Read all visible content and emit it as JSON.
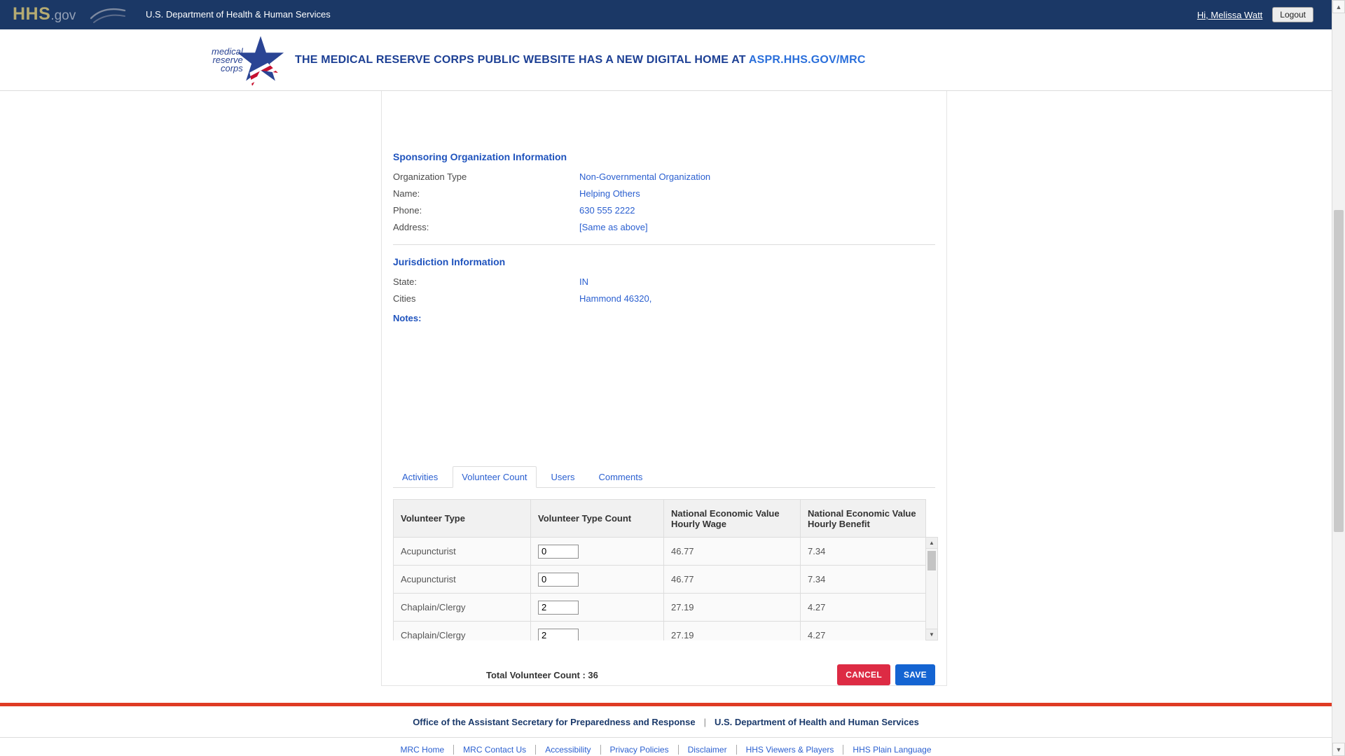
{
  "topbar": {
    "brand_primary": "HHS",
    "brand_suffix": ".gov",
    "department": "U.S. Department of Health & Human Services",
    "greeting": "Hi, Melissa Watt",
    "logout_label": "Logout"
  },
  "banner": {
    "logo_words": [
      "medical",
      "reserve",
      "corps"
    ],
    "message": "THE MEDICAL RESERVE CORPS PUBLIC WEBSITE HAS A NEW DIGITAL HOME AT",
    "link_text": "ASPR.HHS.GOV/MRC"
  },
  "sponsoring": {
    "title": "Sponsoring Organization Information",
    "fields": [
      {
        "label": "Organization Type",
        "value": "Non-Governmental Organization"
      },
      {
        "label": "Name:",
        "value": "Helping Others"
      },
      {
        "label": "Phone:",
        "value": "630 555 2222"
      },
      {
        "label": "Address:",
        "value": "[Same as above]"
      }
    ]
  },
  "jurisdiction": {
    "title": "Jurisdiction Information",
    "fields": [
      {
        "label": "State:",
        "value": "IN"
      },
      {
        "label": "Cities",
        "value": "Hammond 46320,"
      }
    ],
    "notes_label": "Notes:"
  },
  "tabs": [
    {
      "label": "Activities",
      "active": false
    },
    {
      "label": "Volunteer Count",
      "active": true
    },
    {
      "label": "Users",
      "active": false
    },
    {
      "label": "Comments",
      "active": false
    }
  ],
  "table": {
    "columns": [
      "Volunteer Type",
      "Volunteer Type Count",
      "National Economic Value Hourly Wage",
      "National Economic Value Hourly Benefit"
    ],
    "rows": [
      {
        "type": "Acupuncturist",
        "count": "0",
        "wage": "46.77",
        "benefit": "7.34"
      },
      {
        "type": "Acupuncturist",
        "count": "0",
        "wage": "46.77",
        "benefit": "7.34"
      },
      {
        "type": "Chaplain/Clergy",
        "count": "2",
        "wage": "27.19",
        "benefit": "4.27"
      },
      {
        "type": "Chaplain/Clergy",
        "count": "2",
        "wage": "27.19",
        "benefit": "4.27"
      }
    ],
    "total_label": "Total Volunteer Count : 36"
  },
  "actions": {
    "cancel_label": "CANCEL",
    "save_label": "SAVE"
  },
  "footer": {
    "org_left": "Office of the Assistant Secretary for Preparedness and Response",
    "separator": "|",
    "org_right": "U.S. Department of Health and Human Services",
    "links": [
      "MRC Home",
      "MRC Contact Us",
      "Accessibility",
      "Privacy Policies",
      "Disclaimer",
      "HHS Viewers & Players",
      "HHS Plain Language"
    ]
  },
  "colors": {
    "navy": "#1b3866",
    "heading_blue": "#1f53bd",
    "link_blue": "#2a5fd0",
    "cancel_red": "#dd2b44",
    "save_blue": "#1464d2",
    "footer_red": "#df3b24"
  }
}
